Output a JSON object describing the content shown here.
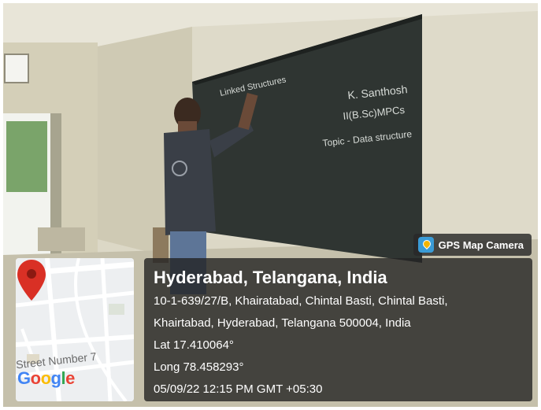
{
  "overlay": {
    "app_badge": "GPS Map Camera",
    "location_title": "Hyderabad, Telangana, India",
    "address_line_1": "10-1-639/27/B, Khairatabad, Chintal Basti, Chintal Basti,",
    "address_line_2": "Khairtabad, Hyderabad, Telangana 500004, India",
    "latitude": "Lat 17.410064°",
    "longitude": "Long 78.458293°",
    "datetime": "05/09/22 12:15 PM GMT +05:30"
  },
  "map": {
    "street_label": "Street Number 7",
    "logo_letters": [
      "G",
      "o",
      "o",
      "g",
      "l",
      "e"
    ],
    "logo_colors": [
      "#4285F4",
      "#EA4335",
      "#FBBC05",
      "#4285F4",
      "#34A853",
      "#EA4335"
    ],
    "pin_color": "#d93025"
  },
  "blackboard_text": {
    "top": "Linked Structures",
    "name": "K. Santhosh",
    "class": "II(B.Sc)MPCs",
    "topic": "Topic - Data structure"
  }
}
